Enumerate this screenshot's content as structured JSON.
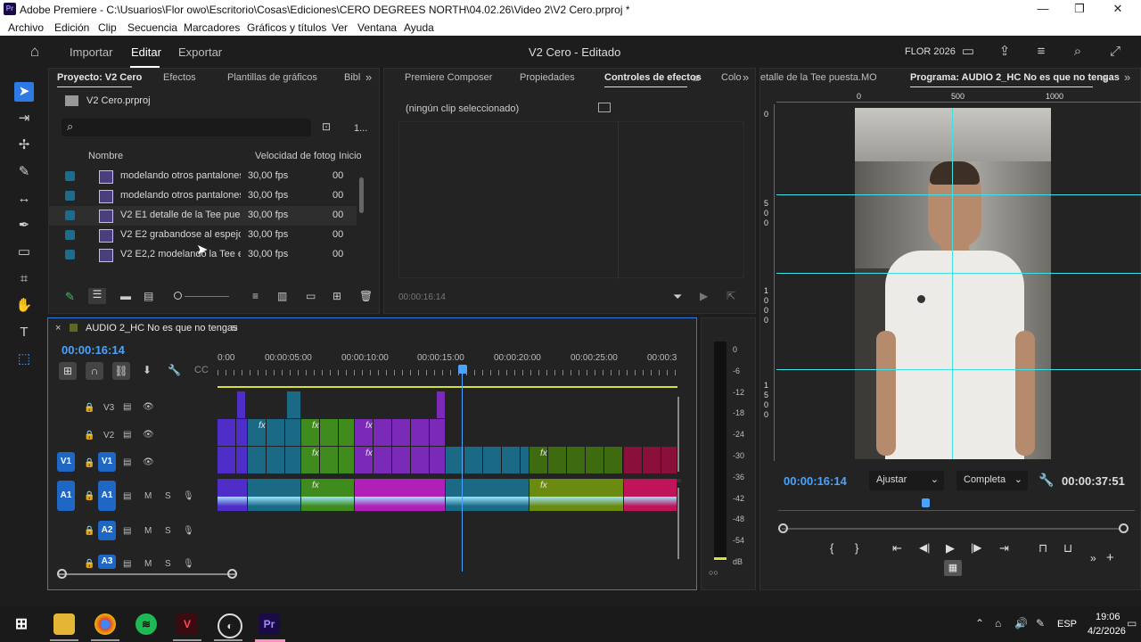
{
  "titlebar": {
    "title": "Adobe Premiere - C:\\Usuarios\\Flor owo\\Escritorio\\Cosas\\Ediciones\\CERO DEGREES NORTH\\04.02.26\\Video 2\\V2 Cero.prproj *",
    "app_icon": "Pr",
    "minimize": "—",
    "restore": "❐",
    "close": "✕"
  },
  "menu": [
    "Archivo",
    "Edición",
    "Clip",
    "Secuencia",
    "Marcadores",
    "Gráficos y títulos",
    "Ver",
    "Ventana",
    "Ayuda"
  ],
  "header": {
    "tabs": [
      "Importar",
      "Editar",
      "Exportar"
    ],
    "active_tab": "Editar",
    "doc_title": "V2 Cero - Editado",
    "workspace": "FLOR 2026"
  },
  "project_panel": {
    "tabs": [
      "Proyecto: V2 Cero",
      "Efectos",
      "Plantillas de gráficos",
      "Bibl"
    ],
    "file": "V2 Cero.prproj",
    "count": "1...",
    "columns": [
      "Nombre",
      "Velocidad de fotogr",
      "Inicio"
    ],
    "rows": [
      {
        "name": "modelando otros pantalones",
        "fps": "30,00 fps",
        "start": "00"
      },
      {
        "name": "modelando otros pantalones",
        "fps": "30,00 fps",
        "start": "00"
      },
      {
        "name": "V2 E1 detalle de la Tee puest",
        "fps": "30,00 fps",
        "start": "00"
      },
      {
        "name": "V2 E2 grabandose al espejo c",
        "fps": "30,00 fps",
        "start": "00"
      },
      {
        "name": "V2 E2,2 modelando la Tee e",
        "fps": "30,00 fps",
        "start": "00"
      }
    ]
  },
  "effects_panel": {
    "tabs": [
      "Premiere Composer",
      "Propiedades",
      "Controles de efectos",
      "Colo"
    ],
    "no_clip": "(ningún clip seleccionado)",
    "timecode": "00:00:16:14"
  },
  "program_panel": {
    "tabs": [
      "etalle de la Tee puesta.MOV",
      "Programa: AUDIO 2_HC No es que no tengas"
    ],
    "ruler": [
      "0",
      "500",
      "1000"
    ],
    "left_ruler": [
      "0",
      "5\n0\n0",
      "1\n0\n0\n0",
      "1\n5\n0\n0"
    ],
    "timecode": "00:00:16:14",
    "fit": "Ajustar",
    "quality": "Completa",
    "duration": "00:00:37:51"
  },
  "timeline": {
    "sequence": "AUDIO 2_HC No es que no tengas",
    "timecode": "00:00:16:14",
    "ruler": [
      "0:00",
      "00:00:05:00",
      "00:00:10:00",
      "00:00:15:00",
      "00:00:20:00",
      "00:00:25:00",
      "00:00:3"
    ],
    "tracks_video": [
      "V3",
      "V2",
      "V1"
    ],
    "tracks_audio": [
      "A1",
      "A2",
      "A3"
    ],
    "src_v": "V1",
    "src_a": "A1",
    "m": "M",
    "s": "S",
    "fx": "fx"
  },
  "meter": {
    "labels": [
      "0",
      "-6",
      "-12",
      "-18",
      "-24",
      "-30",
      "-36",
      "-42",
      "-48",
      "-54",
      "dB"
    ],
    "solo": "○○"
  },
  "taskbar": {
    "lang": "ESP",
    "time": "19:06",
    "date": "4/2/2026"
  },
  "colors": {
    "accent": "#2d7ae5",
    "guides": "#3fe0e6",
    "playhead": "#4aa3ff"
  }
}
